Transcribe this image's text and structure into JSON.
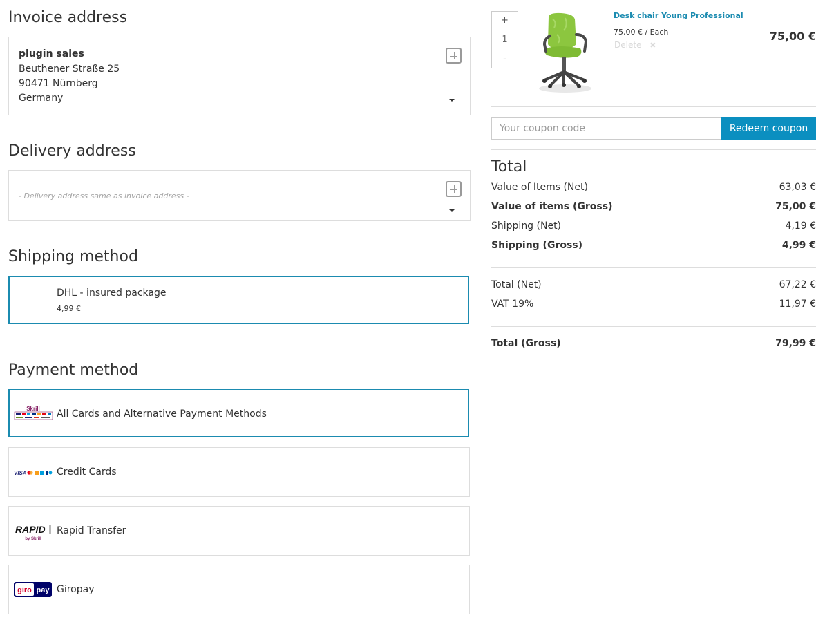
{
  "invoice": {
    "title": "Invoice address",
    "name": "plugin sales",
    "street": "Beuthener Straße 25",
    "city": "90471 Nürnberg",
    "country": "Germany"
  },
  "delivery": {
    "title": "Delivery address",
    "placeholder": "- Delivery address same as invoice address -"
  },
  "shipping": {
    "title": "Shipping method",
    "methods": [
      {
        "name": "DHL - insured package",
        "price": "4,99 €"
      }
    ]
  },
  "payment": {
    "title": "Payment method",
    "methods": [
      {
        "name": "All Cards and Alternative Payment Methods",
        "icon": "skrill-logo",
        "logo_text": "Skrill"
      },
      {
        "name": "Credit Cards",
        "icon": "credit-cards-logo",
        "logo_text": "VISA"
      },
      {
        "name": "Rapid Transfer",
        "icon": "rapid-transfer-logo",
        "logo_text": "RAPID",
        "logo_sub": "by Skrill"
      },
      {
        "name": "Giropay",
        "icon": "giropay-logo",
        "logo_text_a": "giro",
        "logo_text_b": "pay"
      }
    ]
  },
  "basket": {
    "qty_plus": "+",
    "qty_value": "1",
    "qty_minus": "-",
    "item_name": "Desk chair Young Professional",
    "item_unit_price": "75,00 € / Each",
    "delete_label": "Delete",
    "item_price": "75,00 €"
  },
  "coupon": {
    "placeholder": "Your coupon code",
    "button_label": "Redeem coupon"
  },
  "totals": {
    "title": "Total",
    "rows": [
      {
        "label": "Value of Items (Net)",
        "value": "63,03 €"
      },
      {
        "label": "Value of items (Gross)",
        "value": "75,00 €"
      },
      {
        "label": "Shipping (Net)",
        "value": "4,19 €"
      },
      {
        "label": "Shipping (Gross)",
        "value": "4,99 €"
      },
      {
        "label": "Total (Net)",
        "value": "67,22 €"
      },
      {
        "label": "VAT 19%",
        "value": "11,97 €"
      },
      {
        "label": "Total (Gross)",
        "value": "79,99 €"
      }
    ]
  },
  "colors": {
    "accent": "#1b8bb0",
    "button": "#0b8fc0",
    "chair_green": "#8cc63f"
  }
}
